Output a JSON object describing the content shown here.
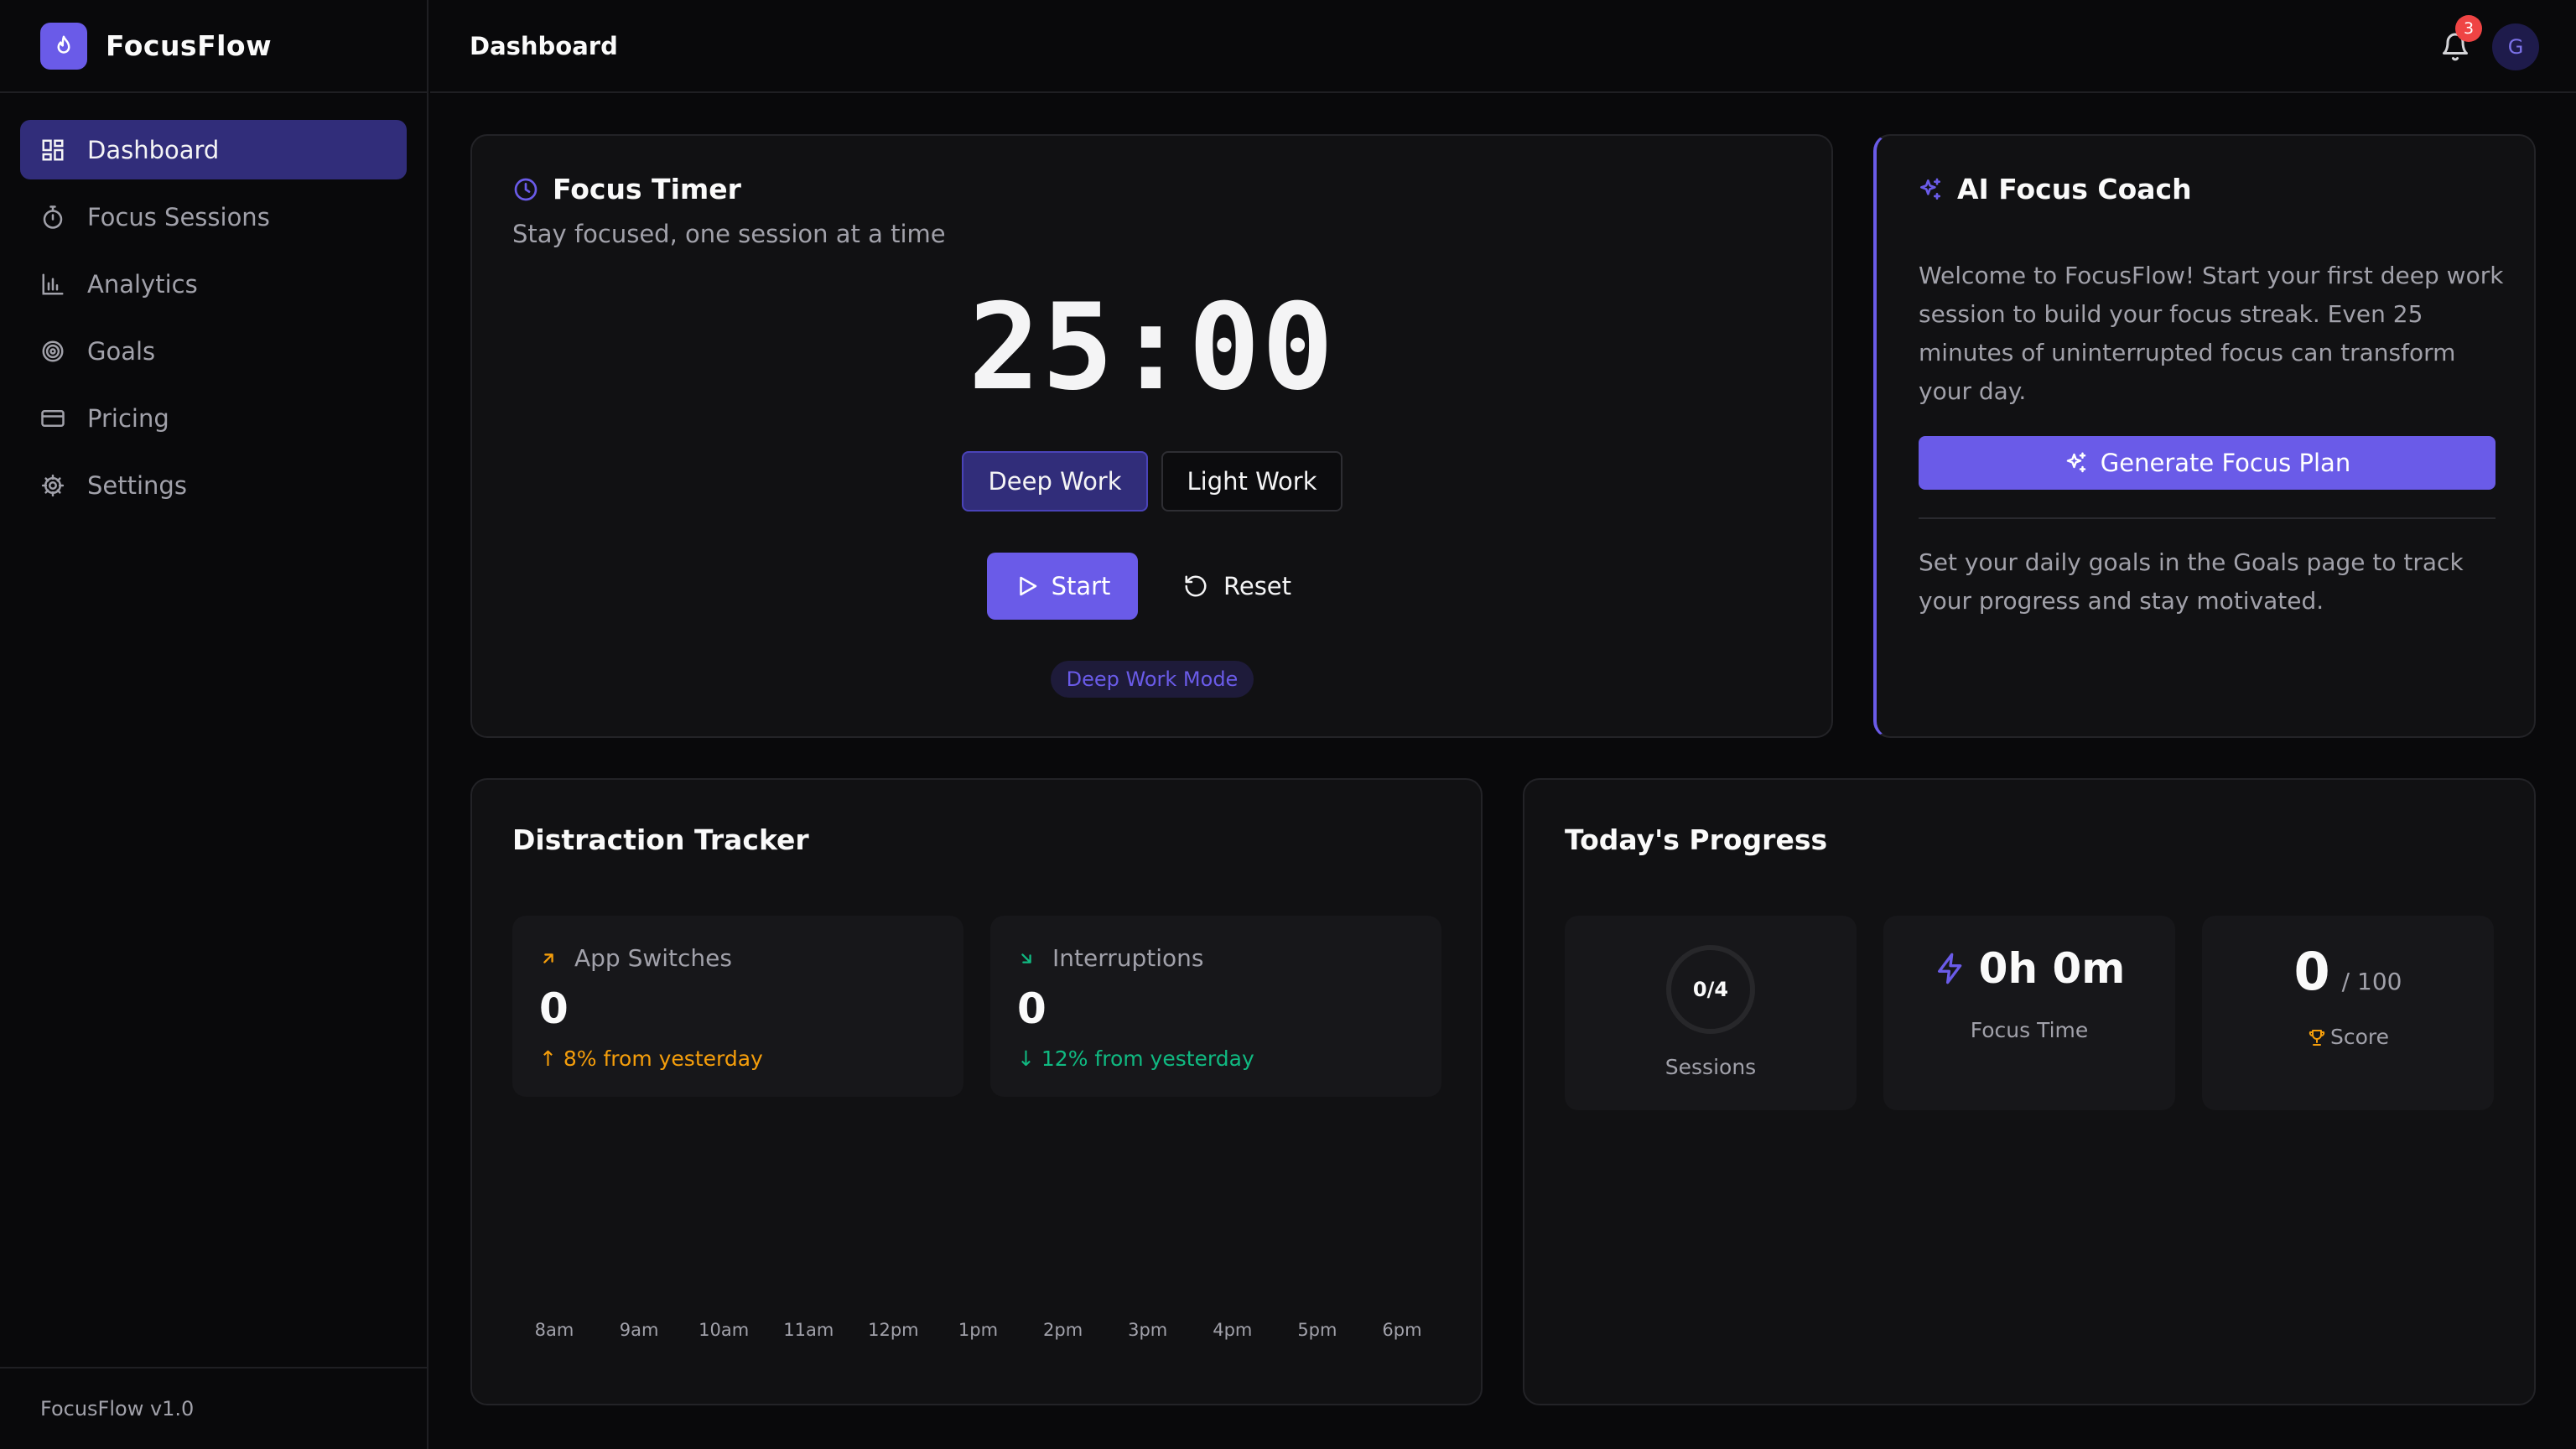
{
  "app": {
    "name": "FocusFlow",
    "version": "FocusFlow v1.0"
  },
  "sidebar": {
    "items": [
      {
        "label": "Dashboard",
        "icon": "dashboard-grid-icon",
        "active": true
      },
      {
        "label": "Focus Sessions",
        "icon": "stopwatch-icon",
        "active": false
      },
      {
        "label": "Analytics",
        "icon": "bar-chart-icon",
        "active": false
      },
      {
        "label": "Goals",
        "icon": "target-icon",
        "active": false
      },
      {
        "label": "Pricing",
        "icon": "credit-card-icon",
        "active": false
      },
      {
        "label": "Settings",
        "icon": "gear-icon",
        "active": false
      }
    ]
  },
  "header": {
    "title": "Dashboard",
    "notification_count": "3",
    "avatar_initial": "G"
  },
  "timer": {
    "title": "Focus Timer",
    "subtitle": "Stay focused, one session at a time",
    "display": "25:00",
    "modes": [
      "Deep Work",
      "Light Work"
    ],
    "selected_mode": "Deep Work",
    "start_label": "Start",
    "reset_label": "Reset",
    "mode_badge": "Deep Work Mode"
  },
  "coach": {
    "title": "AI Focus Coach",
    "message": "Welcome to FocusFlow! Start your first deep work session to build your focus streak. Even 25 minutes of uninterrupted focus can transform your day.",
    "button_label": "Generate Focus Plan",
    "tip": "Set your daily goals in the Goals page to track your progress and stay motivated."
  },
  "distraction": {
    "title": "Distraction Tracker",
    "app_switches": {
      "label": "App Switches",
      "value": "0",
      "delta": "↑ 8% from yesterday"
    },
    "interruptions": {
      "label": "Interruptions",
      "value": "0",
      "delta": "↓ 12% from yesterday"
    },
    "hours": [
      "8am",
      "9am",
      "10am",
      "11am",
      "12pm",
      "1pm",
      "2pm",
      "3pm",
      "4pm",
      "5pm",
      "6pm"
    ]
  },
  "progress": {
    "title": "Today's Progress",
    "sessions": {
      "value": "0/4",
      "label": "Sessions",
      "completed": 0,
      "goal": 4
    },
    "focus_time": {
      "value": "0h 0m",
      "label": "Focus Time"
    },
    "score": {
      "value": "0",
      "max": "/ 100",
      "label": "Score"
    }
  },
  "colors": {
    "accent": "#6a5be8",
    "active_nav": "#312d7a",
    "warning": "#f59e0b",
    "success": "#10b981",
    "badge": "#ef4444"
  }
}
